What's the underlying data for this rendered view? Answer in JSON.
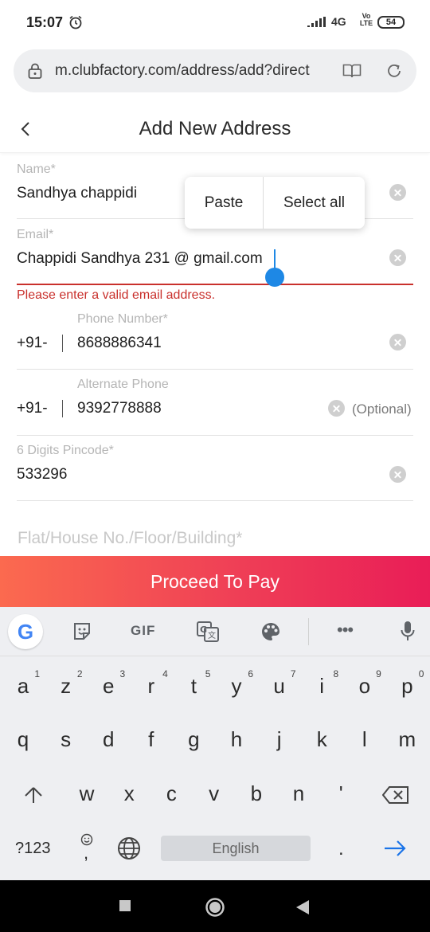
{
  "status_bar": {
    "time": "15:07",
    "network": "4G",
    "volte": "Vo LTE",
    "battery": "54",
    "icons": [
      "alarm-icon",
      "signal-icon",
      "battery-icon"
    ]
  },
  "browser": {
    "url": "m.clubfactory.com/address/add?direct",
    "icons": [
      "lock-icon",
      "reader-mode-icon",
      "refresh-icon"
    ]
  },
  "header": {
    "title": "Add New Address",
    "back_icon": "chevron-left-icon"
  },
  "form": {
    "name": {
      "label": "Name*",
      "value": "Sandhya chappidi"
    },
    "email": {
      "label": "Email*",
      "value": "Chappidi Sandhya 231 @ gmail.com",
      "error": "Please enter a valid email address."
    },
    "phone": {
      "label": "Phone Number*",
      "prefix": "+91-",
      "value": "8688886341"
    },
    "alternate_phone": {
      "label": "Alternate Phone",
      "prefix": "+91-",
      "value": "9392778888",
      "optional": "(Optional)"
    },
    "pincode": {
      "label": "6 Digits Pincode*",
      "value": "533296"
    },
    "flat_placeholder": "Flat/House No./Floor/Building*"
  },
  "context_menu": {
    "paste": "Paste",
    "select_all": "Select all"
  },
  "proceed_button": "Proceed To Pay",
  "keyboard": {
    "toolbar": {
      "gif": "GIF",
      "icons": [
        "google-icon",
        "sticker-icon",
        "gif-icon",
        "translate-icon",
        "palette-icon",
        "more-icon",
        "mic-icon"
      ]
    },
    "row1": [
      {
        "c": "a",
        "n": "1"
      },
      {
        "c": "z",
        "n": "2"
      },
      {
        "c": "e",
        "n": "3"
      },
      {
        "c": "r",
        "n": "4"
      },
      {
        "c": "t",
        "n": "5"
      },
      {
        "c": "y",
        "n": "6"
      },
      {
        "c": "u",
        "n": "7"
      },
      {
        "c": "i",
        "n": "8"
      },
      {
        "c": "o",
        "n": "9"
      },
      {
        "c": "p",
        "n": "0"
      }
    ],
    "row2": [
      "q",
      "s",
      "d",
      "f",
      "g",
      "h",
      "j",
      "k",
      "l",
      "m"
    ],
    "row3": [
      "w",
      "x",
      "c",
      "v",
      "b",
      "n",
      "'"
    ],
    "symbols_key": "?123",
    "comma_key": ",",
    "period_key": ".",
    "space_label": "English"
  },
  "colors": {
    "accent": "#1e88e5",
    "error": "#c9302c",
    "button_gradient_start": "#fb6a4f",
    "button_gradient_end": "#e91d57"
  }
}
